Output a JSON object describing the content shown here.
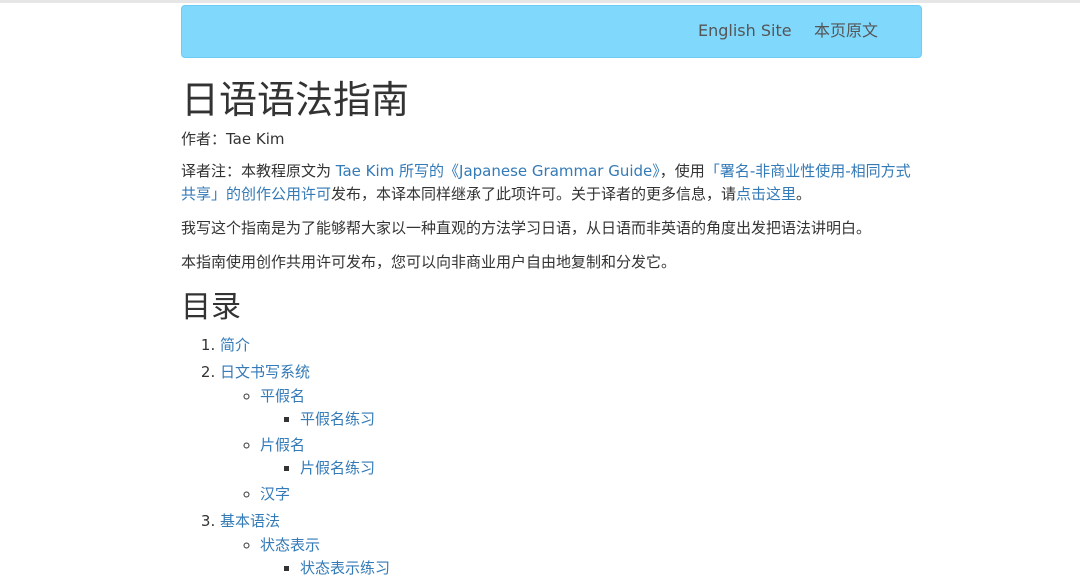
{
  "nav": {
    "english_site": "English Site",
    "original_page": "本页原文"
  },
  "page": {
    "title": "日语语法指南",
    "author": "作者：Tae Kim",
    "note": {
      "prefix": "译者注：本教程原文为 ",
      "guide_link": "Tae Kim 所写的《Japanese Grammar Guide》",
      "mid": "，使用",
      "license_link": "「署名-非商业性使用-相同方式共享」的创作公用许可",
      "after_license": "发布，本译本同样继承了此项许可。关于译者的更多信息，请",
      "click_here_link": "点击这里",
      "end": "。"
    },
    "intro_1": "我写这个指南是为了能够帮大家以一种直观的方法学习日语，从日语而非英语的角度出发把语法讲明白。",
    "intro_2": "本指南使用创作共用许可发布，您可以向非商业用户自由地复制和分发它。",
    "toc_heading": "目录"
  },
  "toc": {
    "intro": "简介",
    "writing_system": "日文书写系统",
    "hiragana": "平假名",
    "hiragana_practice": "平假名练习",
    "katakana": "片假名",
    "katakana_practice": "片假名练习",
    "kanji": "汉字",
    "basic_grammar": "基本语法",
    "state_of_being": "状态表示",
    "state_of_being_practice": "状态表示练习"
  },
  "colors": {
    "navbar_bg": "#81d8fd",
    "link": "#337ab7",
    "text": "#333333"
  }
}
